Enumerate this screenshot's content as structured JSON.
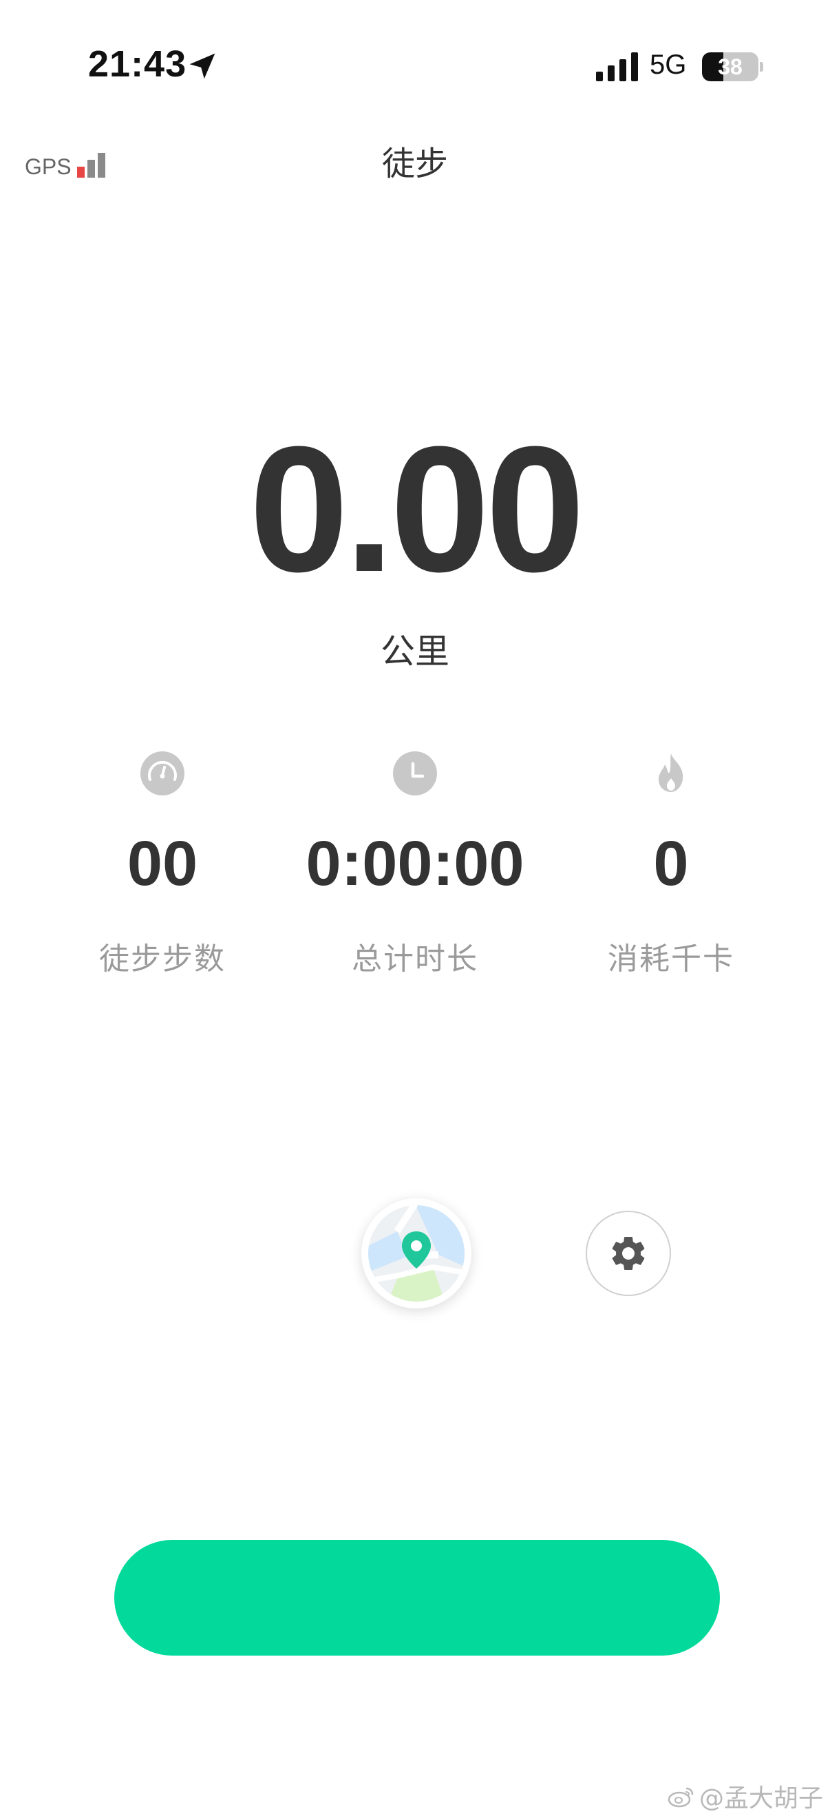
{
  "status_bar": {
    "time": "21:43",
    "network": "5G",
    "battery_percent": "38",
    "battery_level": 0.38,
    "icons": [
      "location-arrow-icon",
      "cellular-signal-icon",
      "battery-icon"
    ]
  },
  "header": {
    "gps_label": "GPS",
    "gps_signal_strength": 1,
    "gps_signal_max": 3,
    "title": "徒步"
  },
  "distance": {
    "value": "0.00",
    "unit": "公里"
  },
  "stats": [
    {
      "icon": "speedometer-icon",
      "value": "00",
      "label": "徒步步数"
    },
    {
      "icon": "clock-icon",
      "value": "0:00:00",
      "label": "总计时长"
    },
    {
      "icon": "flame-icon",
      "value": "0",
      "label": "消耗千卡"
    }
  ],
  "actions": {
    "map_icon": "map-pin-icon",
    "settings_icon": "gear-icon"
  },
  "start_button": {
    "label": ""
  },
  "watermark": {
    "text": "@孟大胡子"
  },
  "colors": {
    "accent": "#02d99b",
    "text_primary": "#333333",
    "text_secondary": "#9a9a9a",
    "icon_gray": "#c8c8c8",
    "gps_active": "#e84545",
    "gps_inactive": "#8a8a8a"
  }
}
